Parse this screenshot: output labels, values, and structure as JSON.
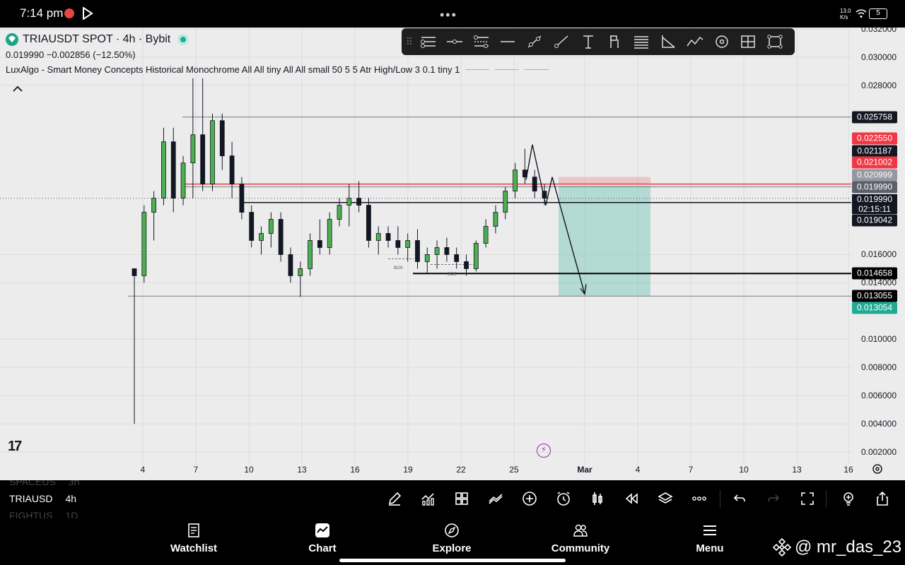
{
  "status_bar": {
    "time": "7:14 pm",
    "network_speed_line1": "13.0",
    "network_speed_line2": "K/s",
    "battery": "5"
  },
  "symbol": {
    "title": "TRIAUSDT SPOT · 4h · Bybit",
    "price_line": "0.019990  −0.002856 (−12.50%)",
    "indicator": "LuxAlgo - Smart Money Concepts Historical Monochrome All All tiny All All small 50 5 5 Atr High/Low 3 0.1 tiny 1"
  },
  "drawing_tools": [
    "horizontal-ray-icon",
    "horizontal-line-icon",
    "parallel-channel-icon",
    "line-icon",
    "trend-line-icon",
    "ray-icon",
    "text-icon",
    "flag-icon",
    "pitchfork-icon",
    "angle-icon",
    "path-icon",
    "circle-icon",
    "crosshair-measure-icon",
    "rectangle-icon"
  ],
  "price_axis": {
    "min": 0.002,
    "max": 0.032,
    "ticks": [
      "0.032000",
      "0.030000",
      "0.028000",
      "0.016000",
      "0.014000",
      "0.010000",
      "0.008000",
      "0.006000",
      "0.004000",
      "0.002000"
    ],
    "tick_values": [
      0.032,
      0.03,
      0.028,
      0.016,
      0.014,
      0.01,
      0.008,
      0.006,
      0.004,
      0.002
    ],
    "badges": [
      {
        "value": 0.025758,
        "text": "0.025758",
        "color": "#131722"
      },
      {
        "value": 0.02255,
        "text": "0.022550",
        "color": "#f23645"
      },
      {
        "value": 0.021187,
        "text": "0.021187",
        "color": "#131722"
      },
      {
        "value": 0.021002,
        "text": "0.021002",
        "color": "#f23645"
      },
      {
        "value": 0.020999,
        "text": "0.020999",
        "color": "#9598a1"
      },
      {
        "value": 0.01999,
        "text": "0.019990",
        "color": "#5d606b"
      },
      {
        "value": 0.019042,
        "text": "0.019042",
        "color": "#131722"
      },
      {
        "value": 0.014658,
        "text": "0.014658",
        "color": "#000000"
      },
      {
        "value": 0.013055,
        "text": "0.013055",
        "color": "#000000"
      },
      {
        "value": 0.013054,
        "text": "0.013054",
        "color": "#22ab94"
      }
    ],
    "current_price": "0.019990",
    "countdown": "02:15:11"
  },
  "time_axis": {
    "labels": [
      "4",
      "7",
      "10",
      "13",
      "16",
      "19",
      "22",
      "25",
      "Mar",
      "4",
      "7",
      "10",
      "13",
      "16"
    ]
  },
  "chart_annotations": {
    "bos_1": "BOS",
    "bos_2": "BOS"
  },
  "chart_data": {
    "type": "candlestick",
    "title": "TRIAUSDT SPOT · 4h · Bybit",
    "ylim": [
      0.002,
      0.032
    ],
    "levels": {
      "resistance_upper": 0.025758,
      "red_line": 0.020999,
      "entry": 0.019042,
      "bos_line": 0.014658,
      "target": 0.013054
    },
    "short_position": {
      "stop": 0.021002,
      "entry": 0.020999,
      "target": 0.013055
    },
    "candles": [
      {
        "o": 0.015,
        "h": 0.015,
        "l": 0.004,
        "c": 0.0145
      },
      {
        "o": 0.0145,
        "h": 0.0195,
        "l": 0.014,
        "c": 0.019
      },
      {
        "o": 0.019,
        "h": 0.0205,
        "l": 0.017,
        "c": 0.02
      },
      {
        "o": 0.02,
        "h": 0.025,
        "l": 0.0195,
        "c": 0.024
      },
      {
        "o": 0.024,
        "h": 0.025,
        "l": 0.019,
        "c": 0.02
      },
      {
        "o": 0.02,
        "h": 0.023,
        "l": 0.0195,
        "c": 0.0225
      },
      {
        "o": 0.0225,
        "h": 0.0285,
        "l": 0.02,
        "c": 0.0245
      },
      {
        "o": 0.0245,
        "h": 0.0285,
        "l": 0.0205,
        "c": 0.021
      },
      {
        "o": 0.021,
        "h": 0.026,
        "l": 0.0205,
        "c": 0.0255
      },
      {
        "o": 0.0255,
        "h": 0.026,
        "l": 0.022,
        "c": 0.023
      },
      {
        "o": 0.023,
        "h": 0.024,
        "l": 0.02,
        "c": 0.021
      },
      {
        "o": 0.021,
        "h": 0.0215,
        "l": 0.0185,
        "c": 0.019
      },
      {
        "o": 0.019,
        "h": 0.0195,
        "l": 0.0165,
        "c": 0.017
      },
      {
        "o": 0.017,
        "h": 0.018,
        "l": 0.016,
        "c": 0.0175
      },
      {
        "o": 0.0175,
        "h": 0.019,
        "l": 0.0165,
        "c": 0.0185
      },
      {
        "o": 0.0185,
        "h": 0.019,
        "l": 0.0155,
        "c": 0.016
      },
      {
        "o": 0.016,
        "h": 0.0165,
        "l": 0.014,
        "c": 0.0145
      },
      {
        "o": 0.0145,
        "h": 0.0155,
        "l": 0.013,
        "c": 0.015
      },
      {
        "o": 0.015,
        "h": 0.0175,
        "l": 0.0145,
        "c": 0.017
      },
      {
        "o": 0.017,
        "h": 0.0185,
        "l": 0.016,
        "c": 0.0165
      },
      {
        "o": 0.0165,
        "h": 0.019,
        "l": 0.016,
        "c": 0.0185
      },
      {
        "o": 0.0185,
        "h": 0.02,
        "l": 0.018,
        "c": 0.0195
      },
      {
        "o": 0.0195,
        "h": 0.021,
        "l": 0.018,
        "c": 0.02
      },
      {
        "o": 0.02,
        "h": 0.0212,
        "l": 0.019,
        "c": 0.0195
      },
      {
        "o": 0.0195,
        "h": 0.02,
        "l": 0.0165,
        "c": 0.017
      },
      {
        "o": 0.017,
        "h": 0.018,
        "l": 0.016,
        "c": 0.0175
      },
      {
        "o": 0.0175,
        "h": 0.018,
        "l": 0.0165,
        "c": 0.017
      },
      {
        "o": 0.017,
        "h": 0.018,
        "l": 0.016,
        "c": 0.0165
      },
      {
        "o": 0.0165,
        "h": 0.0175,
        "l": 0.0155,
        "c": 0.017
      },
      {
        "o": 0.017,
        "h": 0.0178,
        "l": 0.015,
        "c": 0.0155
      },
      {
        "o": 0.0155,
        "h": 0.0165,
        "l": 0.0146,
        "c": 0.016
      },
      {
        "o": 0.016,
        "h": 0.017,
        "l": 0.015,
        "c": 0.0165
      },
      {
        "o": 0.0165,
        "h": 0.0172,
        "l": 0.0155,
        "c": 0.016
      },
      {
        "o": 0.016,
        "h": 0.0165,
        "l": 0.015,
        "c": 0.0155
      },
      {
        "o": 0.0155,
        "h": 0.016,
        "l": 0.0145,
        "c": 0.015
      },
      {
        "o": 0.015,
        "h": 0.017,
        "l": 0.0148,
        "c": 0.0168
      },
      {
        "o": 0.0168,
        "h": 0.0185,
        "l": 0.0165,
        "c": 0.018
      },
      {
        "o": 0.018,
        "h": 0.0195,
        "l": 0.0175,
        "c": 0.019
      },
      {
        "o": 0.019,
        "h": 0.0208,
        "l": 0.0185,
        "c": 0.0205
      },
      {
        "o": 0.0205,
        "h": 0.0225,
        "l": 0.02,
        "c": 0.022
      },
      {
        "o": 0.022,
        "h": 0.0235,
        "l": 0.021,
        "c": 0.0215
      },
      {
        "o": 0.0215,
        "h": 0.022,
        "l": 0.02,
        "c": 0.0205
      },
      {
        "o": 0.0205,
        "h": 0.021,
        "l": 0.0195,
        "c": 0.02
      }
    ]
  },
  "bottom_toolbar": {
    "watchlist_prev": "SPACEUS",
    "watchlist_prev_tf": "3h",
    "watchlist_current": "TRIAUSD",
    "watchlist_current_tf": "4h",
    "watchlist_next": "FIGHTUS",
    "watchlist_next_tf": "1D"
  },
  "bottom_nav": {
    "items": [
      {
        "label": "Watchlist",
        "icon": "watchlist-icon"
      },
      {
        "label": "Chart",
        "icon": "chart-icon"
      },
      {
        "label": "Explore",
        "icon": "compass-icon"
      },
      {
        "label": "Community",
        "icon": "community-icon"
      },
      {
        "label": "Menu",
        "icon": "menu-icon"
      }
    ],
    "watermark": "@ mr_das_23"
  }
}
